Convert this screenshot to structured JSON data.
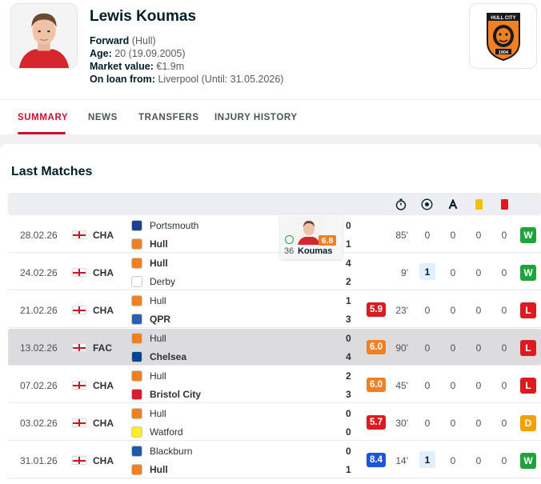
{
  "player": {
    "name": "Lewis Koumas",
    "position_label": "Forward",
    "position_club": "(Hull)",
    "age_label": "Age:",
    "age_value": "20 (19.09.2005)",
    "market_label": "Market value:",
    "market_value": "€1.9m",
    "loan_label": "On loan from:",
    "loan_value": "Liverpool (Until: 31.05.2026)"
  },
  "club_logo": {
    "text_top": "HULL CITY",
    "text_bottom": "1904"
  },
  "tabs": [
    "SUMMARY",
    "NEWS",
    "TRANSFERS",
    "INJURY HISTORY"
  ],
  "section_title": "Last Matches",
  "table_header_icons": [
    "stopwatch-icon",
    "ball-icon",
    "assist-icon",
    "yellow-card-icon",
    "red-card-icon"
  ],
  "colors": {
    "accent": "#c8102e",
    "win": "#1fa33a",
    "loss": "#dc1a22",
    "draw": "#f2a200",
    "rating_red": "#dc1a22",
    "rating_orange": "#f08022",
    "rating_blue": "#1b56d8"
  },
  "matches": [
    {
      "date": "28.02.26",
      "comp": "CHA",
      "home": "Portsmouth",
      "away": "Hull",
      "home_score": "0",
      "away_score": "1",
      "bold": "away",
      "rating": "",
      "minutes": "85'",
      "goals": "0",
      "assists": "0",
      "yellow": "0",
      "red": "0",
      "result": "W"
    },
    {
      "date": "24.02.26",
      "comp": "CHA",
      "home": "Hull",
      "away": "Derby",
      "home_score": "4",
      "away_score": "2",
      "bold": "home",
      "rating": "",
      "minutes": "9'",
      "goals": "1",
      "assists": "0",
      "yellow": "0",
      "red": "0",
      "result": "W"
    },
    {
      "date": "21.02.26",
      "comp": "CHA",
      "home": "Hull",
      "away": "QPR",
      "home_score": "1",
      "away_score": "3",
      "bold": "away",
      "rating": "5.9",
      "minutes": "23'",
      "goals": "0",
      "assists": "0",
      "yellow": "0",
      "red": "0",
      "result": "L"
    },
    {
      "date": "13.02.26",
      "comp": "FAC",
      "home": "Hull",
      "away": "Chelsea",
      "home_score": "0",
      "away_score": "4",
      "bold": "away",
      "rating": "6.0",
      "minutes": "90'",
      "goals": "0",
      "assists": "0",
      "yellow": "0",
      "red": "0",
      "result": "L"
    },
    {
      "date": "07.02.26",
      "comp": "CHA",
      "home": "Hull",
      "away": "Bristol City",
      "home_score": "2",
      "away_score": "3",
      "bold": "away",
      "rating": "6.0",
      "minutes": "45'",
      "goals": "0",
      "assists": "0",
      "yellow": "0",
      "red": "0",
      "result": "L"
    },
    {
      "date": "03.02.26",
      "comp": "CHA",
      "home": "Hull",
      "away": "Watford",
      "home_score": "0",
      "away_score": "0",
      "bold": "none",
      "rating": "5.7",
      "minutes": "30'",
      "goals": "0",
      "assists": "0",
      "yellow": "0",
      "red": "0",
      "result": "D"
    },
    {
      "date": "31.01.26",
      "comp": "CHA",
      "home": "Blackburn",
      "away": "Hull",
      "home_score": "0",
      "away_score": "1",
      "bold": "away",
      "rating": "8.4",
      "minutes": "14'",
      "goals": "1",
      "assists": "0",
      "yellow": "0",
      "red": "0",
      "result": "W"
    }
  ],
  "popup": {
    "minute": "36",
    "name": "Koumas",
    "rating": "6.8"
  }
}
